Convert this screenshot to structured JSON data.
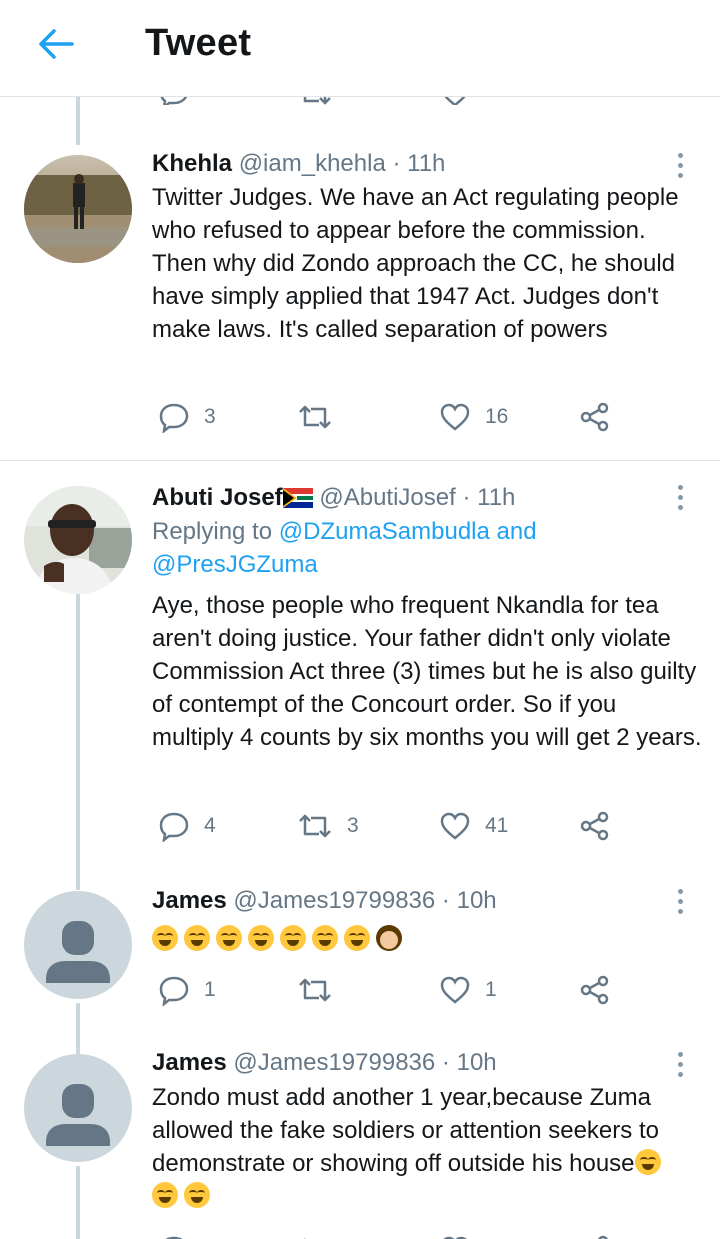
{
  "header": {
    "title": "Tweet",
    "back_icon": "arrow-left-icon"
  },
  "colors": {
    "accent": "#1da1f2",
    "muted": "#657786",
    "text": "#14171a",
    "thread_line": "#ccd6dd"
  },
  "tweets": [
    {
      "name": "Khehla",
      "handle": "@iam_khehla",
      "time": "11h",
      "text": "Twitter Judges. We have an Act regulating people who refused to appear before the commission. Then why did Zondo approach the CC, he should have simply applied that 1947 Act. Judges don't make laws. It's called separation of powers",
      "replies": "3",
      "retweets": "",
      "likes": "16"
    },
    {
      "name": "Abuti Josef",
      "name_emoji": "south-africa-flag",
      "handle": "@AbutiJosef",
      "time": "11h",
      "reply_prefix": "Replying to ",
      "reply_user1": "@DZumaSambudla",
      "reply_and": " and",
      "reply_user2": "@PresJGZuma",
      "text": "Aye, those people who frequent Nkandla for tea aren't doing justice. Your father didn't only violate Commission Act three (3) times but he is also guilty of contempt of the Concourt order. So if you multiply 4 counts by six months you will get 2 years.",
      "replies": "4",
      "retweets": "3",
      "likes": "41"
    },
    {
      "name": "James",
      "handle": "@James19799836",
      "time": "10h",
      "text_emojis": [
        "rolling-laughing",
        "rolling-laughing",
        "rolling-laughing",
        "rolling-laughing",
        "rolling-laughing",
        "rolling-laughing",
        "rolling-laughing",
        "woman-facepalming"
      ],
      "replies": "1",
      "retweets": "",
      "likes": "1"
    },
    {
      "name": "James",
      "handle": "@James19799836",
      "time": "10h",
      "text": "Zondo must add another 1 year,because Zuma allowed the fake soldiers or attention seekers to demonstrate or showing off outside his house",
      "trailing_emojis": [
        "rolling-laughing",
        "rolling-laughing",
        "rolling-laughing"
      ]
    }
  ]
}
